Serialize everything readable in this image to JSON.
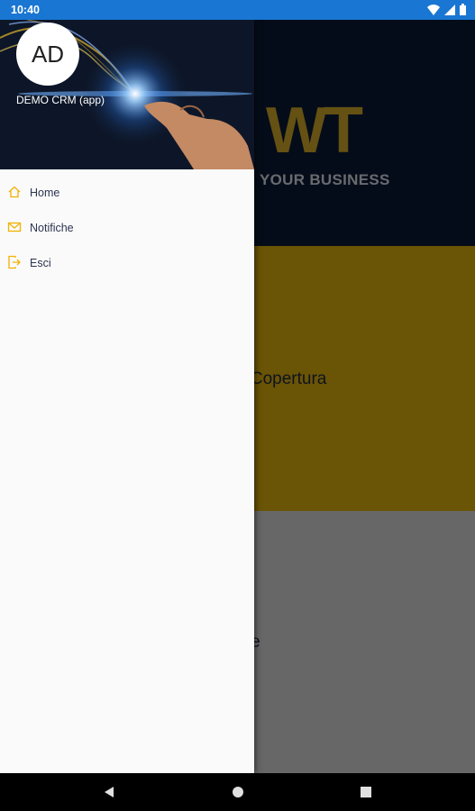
{
  "status_bar": {
    "time": "10:40"
  },
  "background": {
    "banner_logo": "WT",
    "banner_tagline": "YOUR BUSINESS",
    "tile_coverage_label": "a Copertura",
    "tile_notifications_label": "che"
  },
  "drawer": {
    "avatar_initials": "AD",
    "app_name": "DEMO CRM (app)",
    "items": [
      {
        "label": "Home",
        "icon": "home-icon"
      },
      {
        "label": "Notifiche",
        "icon": "mail-icon"
      },
      {
        "label": "Esci",
        "icon": "exit-icon"
      }
    ]
  },
  "colors": {
    "status_bar": "#1976d2",
    "banner": "#0b1833",
    "accent_gold": "#d4a90a",
    "menu_icon": "#f2b200",
    "drawer_bg": "#fafafa"
  },
  "nav_bar": {
    "buttons": [
      "back-icon",
      "home-circle-icon",
      "recents-icon"
    ]
  }
}
